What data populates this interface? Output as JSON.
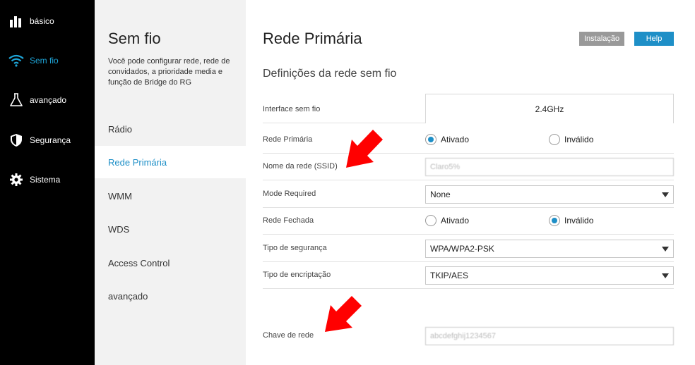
{
  "nav": {
    "items": [
      {
        "label": "básico",
        "icon": "bar-chart-icon"
      },
      {
        "label": "Sem fio",
        "icon": "wifi-icon",
        "active": true
      },
      {
        "label": "avançado",
        "icon": "flask-icon"
      },
      {
        "label": "Segurança",
        "icon": "shield-icon"
      },
      {
        "label": "Sistema",
        "icon": "gear-icon"
      }
    ],
    "active_color": "#1ea5d8"
  },
  "subnav": {
    "title": "Sem fio",
    "description": "Você pode configurar rede, rede de convidados, a prioridade media e função de Bridge do RG",
    "items": [
      {
        "label": "Rádio"
      },
      {
        "label": "Rede Primária",
        "active": true
      },
      {
        "label": "WMM"
      },
      {
        "label": "WDS"
      },
      {
        "label": "Access Control"
      },
      {
        "label": "avançado"
      }
    ]
  },
  "main": {
    "title": "Rede Primária",
    "install_button": "Instalação",
    "help_button": "Help",
    "section_title": "Definições da rede sem fio",
    "fields": {
      "interface": {
        "label": "Interface sem fio",
        "value": "2.4GHz"
      },
      "primary_network": {
        "label": "Rede Primária",
        "option_on": "Ativado",
        "option_off": "Inválido",
        "selected": "Ativado"
      },
      "ssid": {
        "label": "Nome da rede (SSID)",
        "value": "Claro5%"
      },
      "mode_required": {
        "label": "Mode Required",
        "value": "None"
      },
      "closed_network": {
        "label": "Rede Fechada",
        "option_on": "Ativado",
        "option_off": "Inválido",
        "selected": "Inválido"
      },
      "security_type": {
        "label": "Tipo de segurança",
        "value": "WPA/WPA2-PSK"
      },
      "encryption_type": {
        "label": "Tipo de encriptação",
        "value": "TKIP/AES"
      },
      "network_key": {
        "label": "Chave de rede",
        "value": "abcdefghij1234567"
      }
    }
  },
  "colors": {
    "accent": "#1e8fc7",
    "annotation_arrow": "#ff0000"
  }
}
